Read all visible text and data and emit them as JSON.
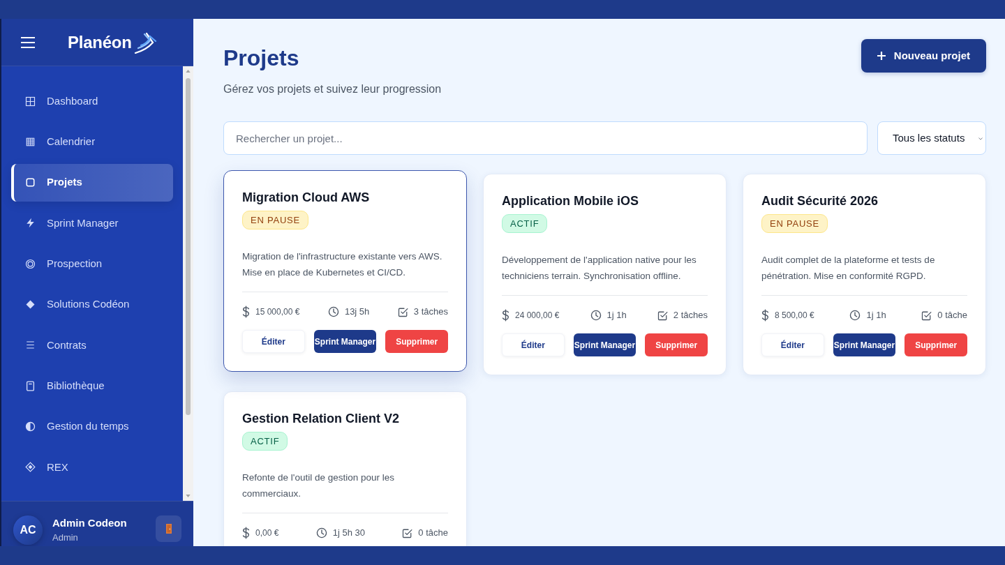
{
  "sidebar": {
    "logo": "Planéon",
    "nav_items": [
      {
        "label": "Dashboard",
        "selected": false
      },
      {
        "label": "Calendrier",
        "selected": false
      },
      {
        "label": "Projets",
        "selected": true
      },
      {
        "label": "Sprint Manager",
        "selected": false
      },
      {
        "label": "Prospection",
        "selected": false
      },
      {
        "label": "Solutions Codéon",
        "selected": false
      },
      {
        "label": "Contrats",
        "selected": false
      },
      {
        "label": "Bibliothèque",
        "selected": false
      },
      {
        "label": "Gestion du temps",
        "selected": false
      },
      {
        "label": "REX",
        "selected": false
      }
    ],
    "user": {
      "initials": "AC",
      "name": "Admin Codeon",
      "role": "Admin"
    }
  },
  "header": {
    "title": "Projets",
    "subtitle": "Gérez vos projets et suivez leur progression",
    "new_button": "Nouveau projet"
  },
  "filters": {
    "search": {
      "placeholder": "Rechercher un projet..."
    },
    "status_select": {
      "value": "Tous les statuts"
    }
  },
  "projects": [
    {
      "title": "Migration Cloud AWS",
      "selected": true,
      "status": {
        "label": "EN PAUSE",
        "kind": "paused"
      },
      "description": "Migration de l'infrastructure existante vers AWS. Mise en place de Kubernetes et CI/CD.",
      "metrics": [
        {
          "kind": "budget",
          "text": "15 000,00 €"
        },
        {
          "kind": "time",
          "text": "13j 5h"
        },
        {
          "kind": "tasks",
          "text": "3 tâches"
        }
      ],
      "actions": [
        {
          "kind": "edit",
          "label": "Éditer"
        },
        {
          "kind": "sprint",
          "label": "Sprint Manager"
        },
        {
          "kind": "delete",
          "label": "Supprimer"
        }
      ]
    },
    {
      "title": "Application Mobile iOS",
      "selected": false,
      "status": {
        "label": "ACTIF",
        "kind": "active"
      },
      "description": "Développement de l'application native pour les techniciens terrain. Synchronisation offline.",
      "metrics": [
        {
          "kind": "budget",
          "text": "24 000,00 €"
        },
        {
          "kind": "time",
          "text": "1j 1h"
        },
        {
          "kind": "tasks",
          "text": "2 tâches"
        }
      ],
      "actions": [
        {
          "kind": "edit",
          "label": "Éditer"
        },
        {
          "kind": "sprint",
          "label": "Sprint Manager"
        },
        {
          "kind": "delete",
          "label": "Supprimer"
        }
      ]
    },
    {
      "title": "Audit Sécurité 2026",
      "selected": false,
      "status": {
        "label": "EN PAUSE",
        "kind": "paused"
      },
      "description": "Audit complet de la plateforme et tests de pénétration. Mise en conformité RGPD.",
      "metrics": [
        {
          "kind": "budget",
          "text": "8 500,00 €"
        },
        {
          "kind": "time",
          "text": "1j 1h"
        },
        {
          "kind": "tasks",
          "text": "0 tâche"
        }
      ],
      "actions": [
        {
          "kind": "edit",
          "label": "Éditer"
        },
        {
          "kind": "sprint",
          "label": "Sprint Manager"
        },
        {
          "kind": "delete",
          "label": "Supprimer"
        }
      ]
    },
    {
      "title": "Gestion Relation Client V2",
      "selected": false,
      "status": {
        "label": "ACTIF",
        "kind": "active"
      },
      "description": "Refonte de l'outil de gestion pour les commerciaux.",
      "metrics": [
        {
          "kind": "budget",
          "text": "0,00 €"
        },
        {
          "kind": "time",
          "text": "1j 5h 30"
        },
        {
          "kind": "tasks",
          "text": "0 tâche"
        }
      ]
    }
  ]
}
